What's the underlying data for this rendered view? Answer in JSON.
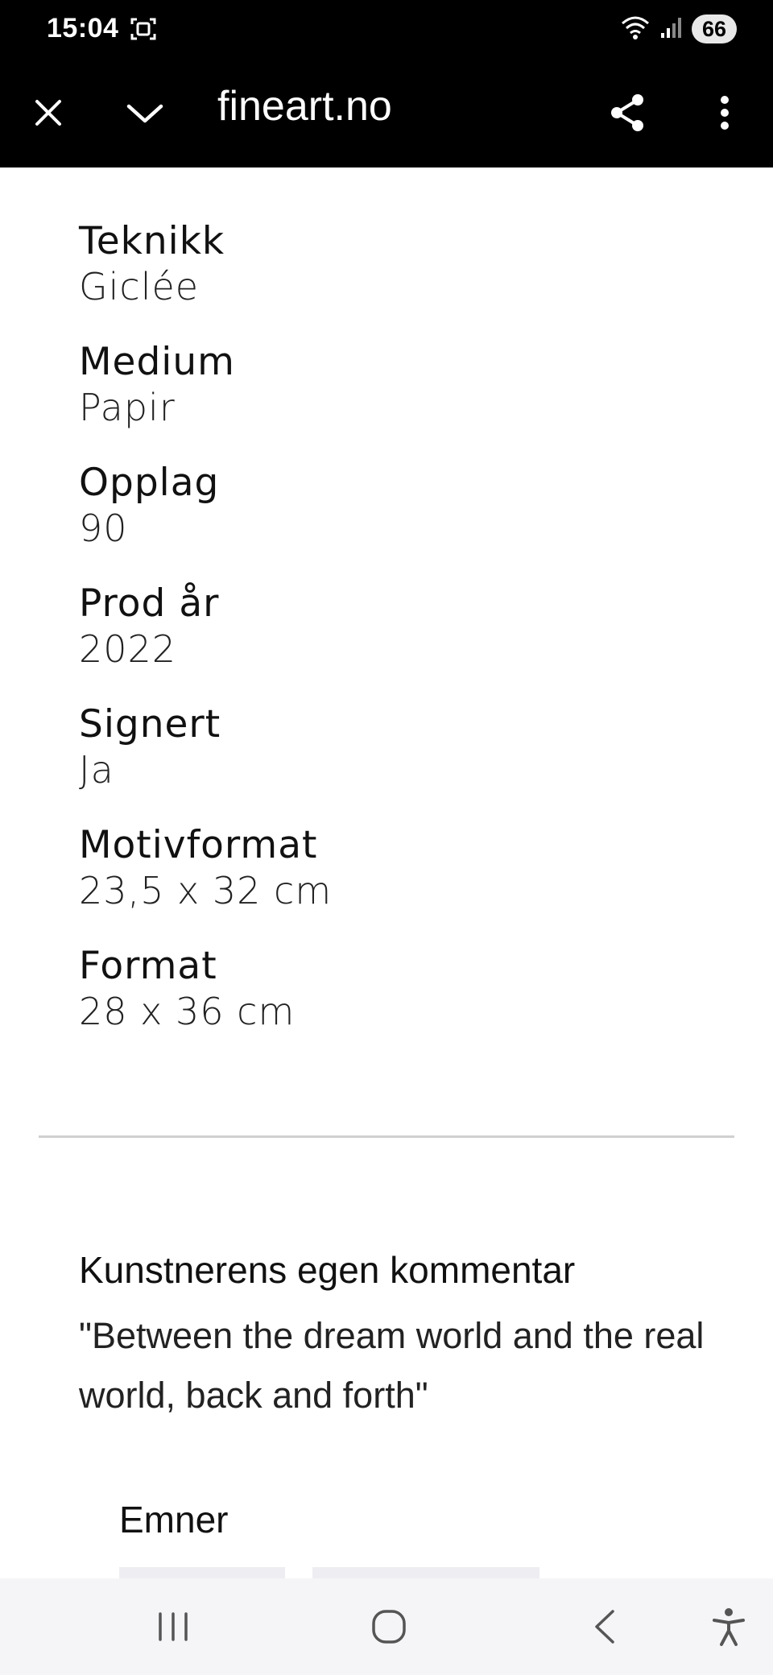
{
  "status_bar": {
    "time": "15:04",
    "battery": "66",
    "icons": [
      "screenshot-icon",
      "wifi-icon",
      "signal-icon"
    ]
  },
  "browser_bar": {
    "url": "fineart.no",
    "icons": [
      "close-icon",
      "chevron-down-icon",
      "share-icon",
      "more-vert-icon"
    ]
  },
  "specs": [
    {
      "label": "Teknikk",
      "value": "Giclée"
    },
    {
      "label": "Medium",
      "value": "Papir"
    },
    {
      "label": "Opplag",
      "value": "90"
    },
    {
      "label": "Prod år",
      "value": "2022"
    },
    {
      "label": "Signert",
      "value": "Ja"
    },
    {
      "label": "Motivformat",
      "value": "23,5 x 32 cm"
    },
    {
      "label": "Format",
      "value": "28 x 36 cm"
    }
  ],
  "comment": {
    "heading": "Kunstnerens egen kommentar",
    "text": "\"Between the dream world and the real world, back and forth\""
  },
  "topics": {
    "heading": "Emner"
  },
  "nav_bar": {
    "icons": [
      "recent-apps-icon",
      "home-icon",
      "back-icon",
      "accessibility-icon"
    ]
  },
  "colors": {
    "header_bg": "#000000",
    "page_bg": "#ffffff",
    "divider": "#d0d0d0",
    "nav_bg": "#f5f5f8"
  }
}
